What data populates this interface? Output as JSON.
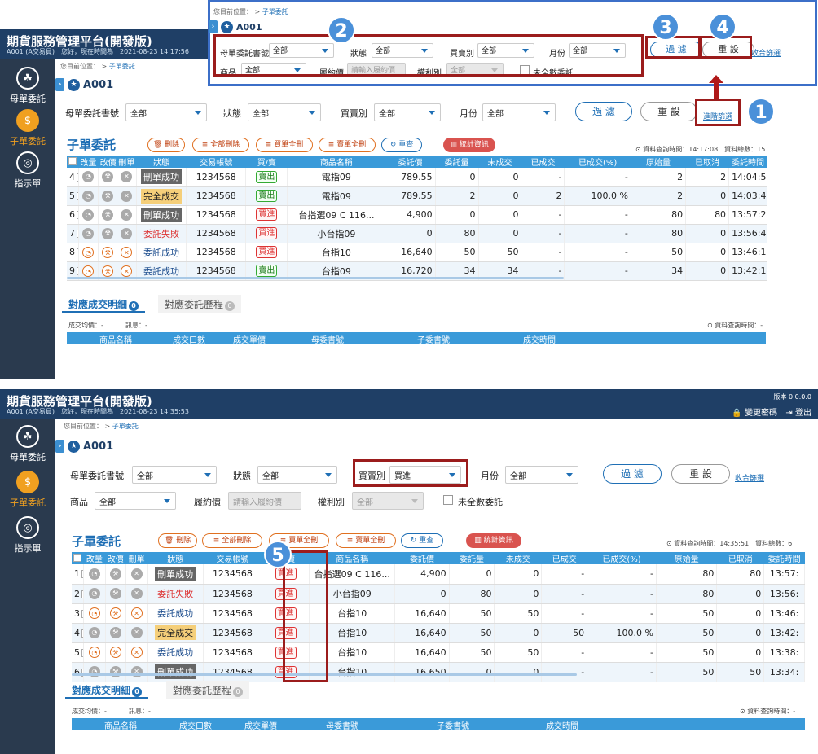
{
  "app": {
    "title": "期貨服務管理平台(開發版)",
    "user_line_1": "A001 (A交易員)　您好，現在時間為　2021-08-23 14:17:56",
    "user_line_2": "A001 (A交易員)　您好，現在時間為　2021-08-23 14:35:53",
    "version": "版本 0.0.0.0",
    "change_password": "變更密碼",
    "logout": "登出"
  },
  "sidebar": {
    "items": [
      {
        "label": "母單委託",
        "icon": "tree-icon"
      },
      {
        "label": "子單委託",
        "icon": "dollar-icon"
      },
      {
        "label": "指示單",
        "icon": "instruction-icon"
      }
    ]
  },
  "breadcrumb": {
    "prefix": "您目前位置：",
    "sep": ">",
    "current": "子單委託"
  },
  "page": {
    "title": "A001"
  },
  "filters": {
    "parent_order_label": "母單委託書號",
    "parent_order_value": "全部",
    "status_label": "狀態",
    "status_value": "全部",
    "buysell_label": "買賣別",
    "buysell_value_1": "全部",
    "buysell_value_2": "買進",
    "month_label": "月份",
    "month_value": "全部",
    "product_label": "商品",
    "product_value": "全部",
    "strike_label": "履約價",
    "strike_placeholder": "請輸入履約價",
    "right_label": "權利別",
    "right_value": "全部",
    "unfilled_label": "未全數委託",
    "filter_btn": "過 濾",
    "reset_btn": "重 設",
    "advanced_link": "進階篩選",
    "collapse_link": "收合篩選"
  },
  "section": {
    "title": "子單委託",
    "btn_delete": "刪除",
    "btn_delete_all": "全部刪除",
    "btn_buy_all": "買單全刪",
    "btn_sell_all": "賣單全刪",
    "btn_refresh": "重查",
    "btn_stats": "統計資訊",
    "meta_1": "⊙ 資料查詢時間：14:17:08　資料總數：15",
    "meta_2": "⊙ 資料查詢時間：14:35:51　資料總數：6"
  },
  "table": {
    "headers": [
      "",
      "改量",
      "改價",
      "刪單",
      "狀態",
      "交易帳號",
      "買/賣",
      "商品名稱",
      "委託價",
      "委託量",
      "未成交",
      "已成交",
      "已成交(%)",
      "原始量",
      "已取消",
      "委託時間"
    ],
    "rows_1": [
      [
        "4",
        "g",
        "刪單成功",
        "st-gray",
        "1234568",
        "賣出",
        "sell",
        "電指09",
        "789.55",
        "0",
        "0",
        "-",
        "-",
        "2",
        "2",
        "14:04:5"
      ],
      [
        "5",
        "g",
        "完全成交",
        "st-orange",
        "1234568",
        "賣出",
        "sell",
        "電指09",
        "789.55",
        "2",
        "0",
        "2",
        "100.0 %",
        "2",
        "0",
        "14:03:4"
      ],
      [
        "6",
        "g",
        "刪單成功",
        "st-gray",
        "1234568",
        "買進",
        "buy",
        "台指選09 C 116...",
        "4,900",
        "0",
        "0",
        "-",
        "-",
        "80",
        "80",
        "13:57:2"
      ],
      [
        "7",
        "g",
        "委託失敗",
        "st-red",
        "1234568",
        "買進",
        "buy",
        "小台指09",
        "0",
        "80",
        "0",
        "-",
        "-",
        "80",
        "0",
        "13:56:4"
      ],
      [
        "8",
        "o",
        "委託成功",
        "st-blue",
        "1234568",
        "買進",
        "buy",
        "台指10",
        "16,640",
        "50",
        "50",
        "-",
        "-",
        "50",
        "0",
        "13:46:1"
      ],
      [
        "9",
        "o",
        "委託成功",
        "st-blue",
        "1234568",
        "賣出",
        "sell",
        "台指09",
        "16,720",
        "34",
        "34",
        "-",
        "-",
        "34",
        "0",
        "13:42:1"
      ]
    ],
    "rows_2": [
      [
        "1",
        "g",
        "刪單成功",
        "st-gray",
        "1234568",
        "買進",
        "buy",
        "台指選09 C 116...",
        "4,900",
        "0",
        "0",
        "-",
        "-",
        "80",
        "80",
        "13:57:"
      ],
      [
        "2",
        "g",
        "委託失敗",
        "st-red",
        "1234568",
        "買進",
        "buy",
        "小台指09",
        "0",
        "80",
        "0",
        "-",
        "-",
        "80",
        "0",
        "13:56:"
      ],
      [
        "3",
        "o",
        "委託成功",
        "st-blue",
        "1234568",
        "買進",
        "buy",
        "台指10",
        "16,640",
        "50",
        "50",
        "-",
        "-",
        "50",
        "0",
        "13:46:"
      ],
      [
        "4",
        "g",
        "完全成交",
        "st-orange",
        "1234568",
        "買進",
        "buy",
        "台指10",
        "16,640",
        "50",
        "0",
        "50",
        "100.0 %",
        "50",
        "0",
        "13:42:"
      ],
      [
        "5",
        "o",
        "委託成功",
        "st-blue",
        "1234568",
        "買進",
        "buy",
        "台指10",
        "16,640",
        "50",
        "50",
        "-",
        "-",
        "50",
        "0",
        "13:38:"
      ],
      [
        "6",
        "g",
        "刪單成功",
        "st-gray",
        "1234568",
        "買進",
        "buy",
        "台指10",
        "16,650",
        "0",
        "0",
        "-",
        "-",
        "50",
        "50",
        "13:34:"
      ]
    ]
  },
  "detail": {
    "tab_fills": "對應成交明細",
    "tab_fills_count": "0",
    "tab_history": "對應委託歷程",
    "tab_history_count": "0",
    "avg_label": "成交均價：-",
    "msg_label": "訊息：-",
    "meta": "⊙ 資料查詢時間：-",
    "headers": [
      "商品名稱",
      "成交口數",
      "成交單價",
      "母委書號",
      "子委書號",
      "成交時間"
    ]
  },
  "callouts": [
    "1",
    "2",
    "3",
    "4",
    "5"
  ]
}
